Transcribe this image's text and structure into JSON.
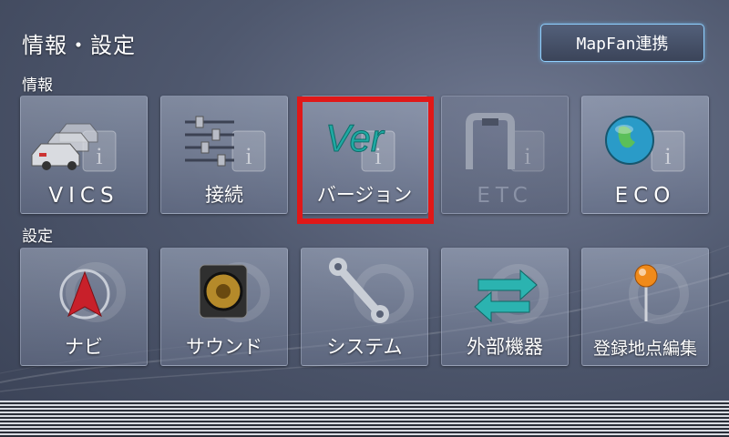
{
  "header": {
    "title": "情報・設定",
    "mapfan_label": "MapFan連携"
  },
  "sections": {
    "info_label": "情報",
    "settings_label": "設定"
  },
  "info_tiles": [
    {
      "label": "VICS",
      "icon": "vics-traffic-cars-icon",
      "enabled": true
    },
    {
      "label": "接続",
      "icon": "connection-sliders-icon",
      "enabled": true
    },
    {
      "label": "バージョン",
      "icon": "version-ver-icon",
      "enabled": true,
      "selected": true
    },
    {
      "label": "ETC",
      "icon": "etc-gate-icon",
      "enabled": false
    },
    {
      "label": "ECO",
      "icon": "eco-globe-icon",
      "enabled": true
    }
  ],
  "settings_tiles": [
    {
      "label": "ナビ",
      "icon": "navi-arrow-icon"
    },
    {
      "label": "サウンド",
      "icon": "speaker-icon"
    },
    {
      "label": "システム",
      "icon": "wrench-icon"
    },
    {
      "label": "外部機器",
      "icon": "external-device-arrows-icon"
    },
    {
      "label": "登録地点編集",
      "icon": "map-pin-icon"
    }
  ],
  "colors": {
    "highlight": "#e01818",
    "mapfan_border": "#8fd0ff"
  }
}
